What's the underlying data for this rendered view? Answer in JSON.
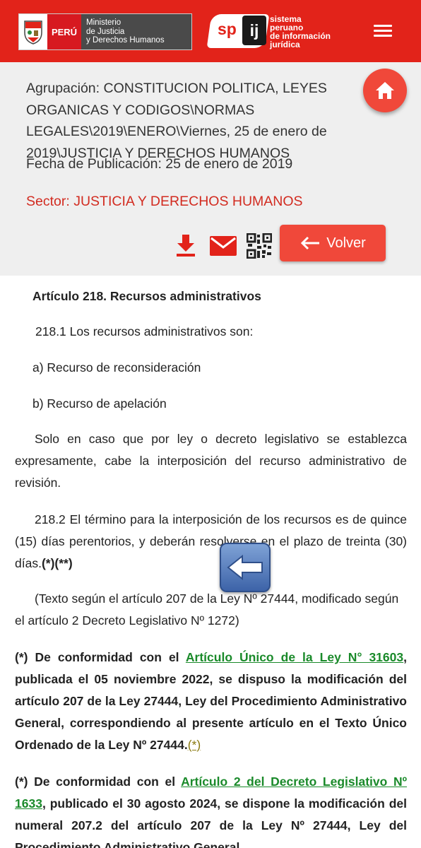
{
  "header": {
    "peru_logo": {
      "country": "PERÚ",
      "ministry_line1": "Ministerio",
      "ministry_line2": "de Justicia",
      "ministry_line3": "y Derechos Humanos"
    },
    "spij_logo": {
      "badge_sp": "sp",
      "badge_ij": "ij",
      "line1": "sistema",
      "line2": "peruano",
      "line3": "de información",
      "line4": "jurídica"
    },
    "menu_icon": "hamburger-icon",
    "colors": {
      "brand_red": "#e2231a",
      "button_red": "#f0483a"
    }
  },
  "info": {
    "agrupacion": "Agrupación: CONSTITUCION POLITICA, LEYES ORGANICAS Y CODIGOS\\NORMAS LEGALES\\2019\\ENERO\\Viernes, 25 de enero de 2019\\JUSTICIA Y DERECHOS HUMANOS",
    "fecha": "Fecha de Publicación: 25 de enero de 2019",
    "sector": "Sector: JUSTICIA Y DERECHOS HUMANOS",
    "volver_label": "Volver",
    "icons": [
      "download-icon",
      "mail-icon",
      "qr-code-icon",
      "home-icon"
    ]
  },
  "article": {
    "title": "Artículo 218. Recursos administrativos",
    "p218_1": "218.1 Los recursos administrativos son:",
    "item_a": "a) Recurso de reconsideración",
    "item_b": "b) Recurso de apelación",
    "p_solo": "Solo en caso que por ley o decreto legislativo se establezca expresamente, cabe la interposición del recurso administrativo de revisión.",
    "p218_2_text": "218.2 El término para la interposición de los recursos es de quince (15) días perentorios, y deberán resolverse en el plazo de treinta (30) días.",
    "p218_2_marks": "(*)(**)",
    "p_texto": "(Texto según el artículo 207 de la Ley Nº 27444, modificado según el artículo 2 Decreto Legislativo Nº 1272)",
    "note1_prefix": "(*) De conformidad con el ",
    "note1_link": "Artículo Único de la Ley N° 31603",
    "note1_body": ", publicada el 05 noviembre 2022, se dispuso la modificación del artículo 207 de la Ley 27444, Ley del Procedimiento Administrativo General, correspondiendo al presente artículo en el Texto Único Ordenado de la Ley Nº 27444.",
    "note1_star": "(*)",
    "note2_prefix": "(*) De conformidad con el ",
    "note2_link": "Artículo 2 del Decreto Legislativo Nº 1633",
    "note2_body": ", publicado el 30 agosto 2024, se dispone la modificación del numeral 207.2 del artículo 207 de la Ley Nº 27444, Ley del Procedimiento Administrativo General,"
  },
  "floating": {
    "back_icon": "back-arrow-icon"
  }
}
